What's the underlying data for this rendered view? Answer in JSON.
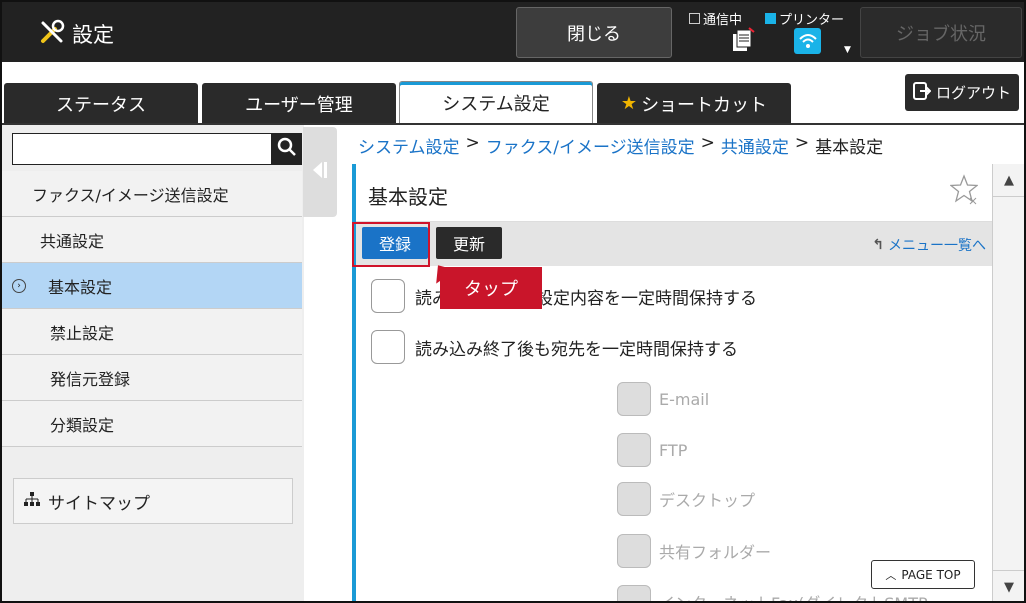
{
  "header": {
    "title": "設定",
    "close_label": "閉じる",
    "status_comm": "通信中",
    "status_printer": "プリンター",
    "job_status_label": "ジョブ状況"
  },
  "tabs": [
    {
      "label": "ステータス"
    },
    {
      "label": "ユーザー管理"
    },
    {
      "label": "システム設定"
    },
    {
      "label": "ショートカット"
    }
  ],
  "logout_label": "ログアウト",
  "sidebar": {
    "search_placeholder": "",
    "items": [
      {
        "label": "ファクス/イメージ送信設定"
      },
      {
        "label": "共通設定"
      },
      {
        "label": "基本設定"
      },
      {
        "label": "禁止設定"
      },
      {
        "label": "発信元登録"
      },
      {
        "label": "分類設定"
      }
    ],
    "sitemap_label": "サイトマップ"
  },
  "breadcrumb": {
    "items": [
      "システム設定",
      "ファクス/イメージ送信設定",
      "共通設定"
    ],
    "current": "基本設定"
  },
  "panel": {
    "title": "基本設定",
    "register_label": "登録",
    "update_label": "更新",
    "menu_link": "メニュー一覧へ"
  },
  "callout": "タップ",
  "options": [
    {
      "label": "読み込み終了後も設定内容を一定時間保持する",
      "visible_label": "読み",
      "visible_rest": "も設定内容を一定時間保持する"
    },
    {
      "label": "読み込み終了後も宛先を一定時間保持する"
    }
  ],
  "sub_options": [
    {
      "label": "E-mail"
    },
    {
      "label": "FTP"
    },
    {
      "label": "デスクトップ"
    },
    {
      "label": "共有フォルダー"
    },
    {
      "label": "インターネットFax(ダイレクトSMTP"
    }
  ],
  "page_top_label": "PAGE TOP",
  "colors": {
    "accent": "#1a9ad6",
    "link": "#1a73c7",
    "callout": "#c9152a"
  }
}
